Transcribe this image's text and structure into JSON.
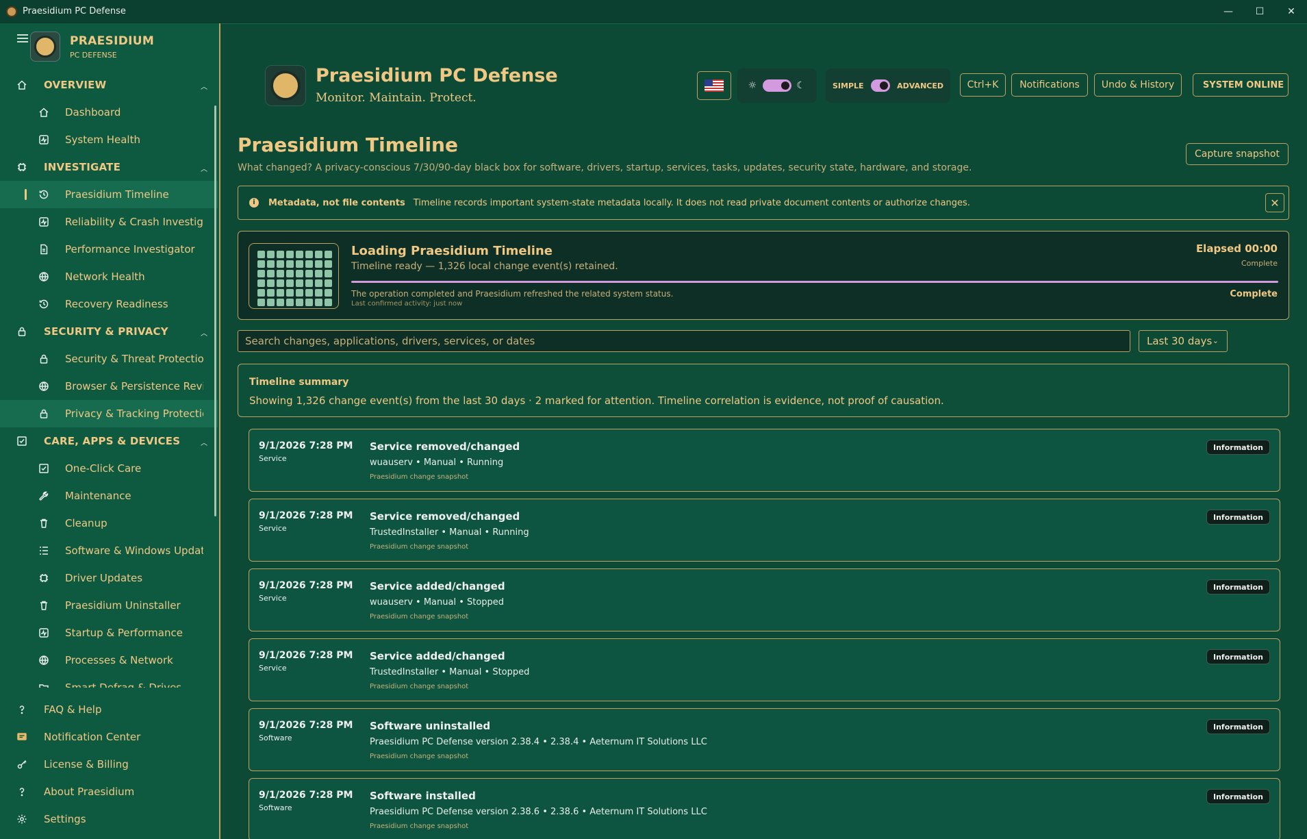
{
  "window": {
    "title": "Praesidium PC Defense",
    "controls": [
      "—",
      "☐",
      "✕"
    ]
  },
  "sidebar": {
    "brand_name": "PRAESIDIUM",
    "brand_sub": "PC DEFENSE",
    "sections": [
      {
        "label": "OVERVIEW",
        "icon": "home-icon",
        "items": [
          {
            "label": "Dashboard",
            "icon": "home-icon"
          },
          {
            "label": "System Health",
            "icon": "pulse-icon"
          }
        ]
      },
      {
        "label": "INVESTIGATE",
        "icon": "chip-icon",
        "items": [
          {
            "label": "Praesidium Timeline",
            "icon": "history-icon",
            "active": true
          },
          {
            "label": "Reliability & Crash Investigator",
            "icon": "pulse-icon"
          },
          {
            "label": "Performance Investigator",
            "icon": "document-icon"
          },
          {
            "label": "Network Health",
            "icon": "globe-icon"
          },
          {
            "label": "Recovery Readiness",
            "icon": "history-icon"
          }
        ]
      },
      {
        "label": "SECURITY & PRIVACY",
        "icon": "lock-icon",
        "items": [
          {
            "label": "Security & Threat Protection",
            "icon": "lock-icon"
          },
          {
            "label": "Browser & Persistence Review",
            "icon": "globe-icon"
          },
          {
            "label": "Privacy & Tracking Protection",
            "icon": "lock-icon",
            "selected": true
          }
        ]
      },
      {
        "label": "CARE, APPS & DEVICES",
        "icon": "checkbox-icon",
        "items": [
          {
            "label": "One-Click Care",
            "icon": "checkbox-icon"
          },
          {
            "label": "Maintenance",
            "icon": "wrench-icon"
          },
          {
            "label": "Cleanup",
            "icon": "trash-icon"
          },
          {
            "label": "Software & Windows Updates",
            "icon": "list-icon"
          },
          {
            "label": "Driver Updates",
            "icon": "chip-icon"
          },
          {
            "label": "Praesidium Uninstaller",
            "icon": "trash-icon"
          },
          {
            "label": "Startup & Performance",
            "icon": "pulse-icon"
          },
          {
            "label": "Processes & Network",
            "icon": "globe-icon"
          },
          {
            "label": "Smart Defrag & Drives",
            "icon": "folder-icon"
          }
        ]
      }
    ],
    "bottom": [
      {
        "label": "FAQ & Help",
        "icon": "question-icon"
      },
      {
        "label": "Notification Center",
        "icon": "message-icon"
      },
      {
        "label": "License & Billing",
        "icon": "key-icon"
      },
      {
        "label": "About Praesidium",
        "icon": "question-icon"
      },
      {
        "label": "Settings",
        "icon": "gear-icon"
      }
    ]
  },
  "header": {
    "app_title": "Praesidium PC Defense",
    "tagline": "Monitor. Maintain. Protect.",
    "mode_simple": "SIMPLE",
    "mode_advanced": "ADVANCED",
    "shortcut": "Ctrl+K",
    "notifications": "Notifications",
    "undo": "Undo & History",
    "status": "SYSTEM ONLINE"
  },
  "page": {
    "title": "Praesidium Timeline",
    "description": "What changed? A privacy-conscious 7/30/90-day black box for software, drivers, startup, services, tasks, updates, security state, hardware, and storage.",
    "capture_button": "Capture snapshot"
  },
  "notice": {
    "title": "Metadata, not file contents",
    "message": "Timeline records important system-state metadata locally. It does not read private document contents or authorize changes."
  },
  "loading": {
    "title": "Loading Praesidium Timeline",
    "subtitle": "Timeline ready — 1,326 local change event(s) retained.",
    "elapsed": "Elapsed 00:00",
    "state_small": "Complete",
    "progress": 1.0,
    "message": "The operation completed and Praesidium refreshed the related system status.",
    "last_activity": "Last confirmed activity: just now",
    "state": "Complete"
  },
  "search": {
    "placeholder": "Search changes, applications, drivers, services, or dates",
    "range": "Last 30 days"
  },
  "summary": {
    "title": "Timeline summary",
    "body": "Showing 1,326 change event(s) from the last 30 days · 2 marked for attention. Timeline correlation is evidence, not proof of causation."
  },
  "events": [
    {
      "date": "9/1/2026 7:28 PM",
      "category": "Service",
      "title": "Service removed/changed",
      "detail": "wuauserv • Manual • Running",
      "source": "Praesidium change snapshot",
      "badge": "Information"
    },
    {
      "date": "9/1/2026 7:28 PM",
      "category": "Service",
      "title": "Service removed/changed",
      "detail": "TrustedInstaller • Manual • Running",
      "source": "Praesidium change snapshot",
      "badge": "Information"
    },
    {
      "date": "9/1/2026 7:28 PM",
      "category": "Service",
      "title": "Service added/changed",
      "detail": "wuauserv • Manual • Stopped",
      "source": "Praesidium change snapshot",
      "badge": "Information"
    },
    {
      "date": "9/1/2026 7:28 PM",
      "category": "Service",
      "title": "Service added/changed",
      "detail": "TrustedInstaller • Manual • Stopped",
      "source": "Praesidium change snapshot",
      "badge": "Information"
    },
    {
      "date": "9/1/2026 7:28 PM",
      "category": "Software",
      "title": "Software uninstalled",
      "detail": "Praesidium PC Defense version 2.38.4 • 2.38.4 • Aeternum IT Solutions LLC",
      "source": "Praesidium change snapshot",
      "badge": "Information"
    },
    {
      "date": "9/1/2026 7:28 PM",
      "category": "Software",
      "title": "Software installed",
      "detail": "Praesidium PC Defense version 2.38.6 • 2.38.6 • Aeternum IT Solutions LLC",
      "source": "Praesidium change snapshot",
      "badge": "Information"
    }
  ]
}
